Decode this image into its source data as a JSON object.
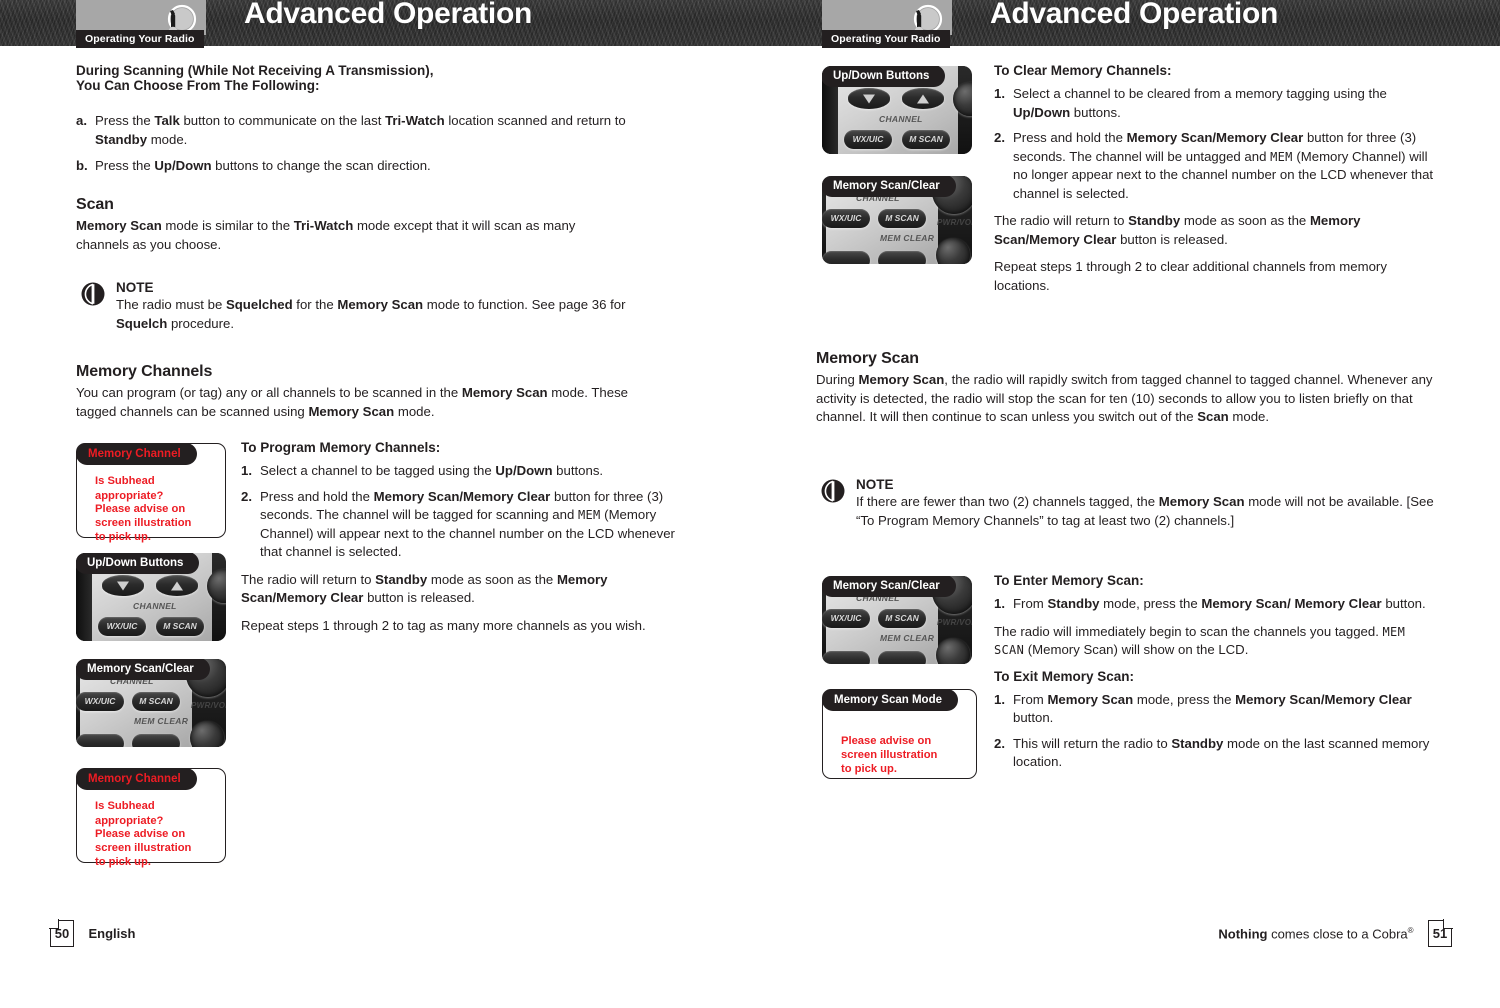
{
  "header": {
    "crumb": "Operating Your Radio",
    "title": "Advanced Operation",
    "logo_icon": "cobra-radio-logo-icon"
  },
  "left_page": {
    "intro_heading_line1": "During Scanning (While Not Receiving A Transmission),",
    "intro_heading_line2": "You Can Choose From The Following:",
    "alpha_items": [
      {
        "marker": "a.",
        "html": "Press the <b>Talk</b> button to communicate on the last <b>Tri-Watch</b> location scanned and return to <b>Standby</b> mode."
      },
      {
        "marker": "b.",
        "html": "Press the <b>Up/Down</b> buttons to change the scan direction."
      }
    ],
    "scan_heading": "Scan",
    "scan_para": "<b>Memory Scan</b> mode is similar to the <b>Tri-Watch</b> mode except that it will scan as many channels as you choose.",
    "note": {
      "title": "NOTE",
      "body": "The radio must be <b>Squelched</b> for the <b>Memory Scan</b> mode to function. See page 36 for <b>Squelch</b> procedure."
    },
    "memch_heading": "Memory Channels",
    "memch_para": "You can program (or tag) any or all channels to be scanned in the <b>Memory Scan</b> mode. These tagged channels can be scanned using <b>Memory Scan</b> mode.",
    "program_heading": "To Program Memory Channels:",
    "program_steps": [
      {
        "marker": "1.",
        "html": "Select a channel to be tagged using the <b>Up/Down</b> buttons."
      },
      {
        "marker": "2.",
        "html": "Press and hold the <b>Memory Scan/Memory Clear</b> button for three (3) seconds. The channel will be tagged for scanning and <span class=\"lcd\">MEM</span> (Memory Channel) will appear next to the channel number on the LCD whenever that channel is selected."
      }
    ],
    "program_after_1": "The radio will return to <b>Standby</b> mode as soon as the <b>Memory Scan/Memory Clear</b> button is released.",
    "program_after_2": "Repeat steps 1 through 2 to tag as many more channels as you wish.",
    "callouts": [
      {
        "tag": "Memory Channel",
        "tag_color": "#ed1c24",
        "type": "advice",
        "lines": [
          "Is Subhead appropriate?",
          "",
          "Please advise on",
          "screen illustration",
          "to pick up."
        ]
      },
      {
        "tag": "Up/Down Buttons",
        "tag_color": "#ffffff",
        "type": "photo",
        "photo": "radio-updown-buttons-photo",
        "photo_labels": [
          "CHANNEL",
          "WX/UIC",
          "M SCAN"
        ]
      },
      {
        "tag": "Memory Scan/Clear",
        "tag_color": "#ffffff",
        "type": "photo",
        "photo": "radio-memory-scan-clear-photo",
        "photo_labels": [
          "CHANNEL",
          "WX/UIC",
          "M SCAN",
          "MEM CLEAR",
          "PWR/VOL"
        ]
      },
      {
        "tag": "Memory Channel",
        "tag_color": "#ed1c24",
        "type": "advice",
        "lines": [
          "Is Subhead appropriate?",
          "",
          "Please advise on",
          "screen illustration",
          "to pick up."
        ]
      }
    ],
    "footer": {
      "page_number": "50",
      "label": "English"
    }
  },
  "right_page": {
    "clear_heading": "To Clear Memory Channels:",
    "clear_steps": [
      {
        "marker": "1.",
        "html": "Select a channel to be cleared from a memory tagging using the <b>Up/Down</b> buttons."
      },
      {
        "marker": "2.",
        "html": "Press and hold the <b>Memory Scan/Memory Clear</b> button for three (3) seconds. The channel will be untagged and <span class=\"lcd\">MEM</span> (Memory Channel) will no longer appear next to the channel number on the LCD whenever that channel is selected."
      }
    ],
    "clear_after_1": "The radio will return to <b>Standby</b> mode as soon as the <b>Memory Scan/Memory Clear</b> button is released.",
    "clear_after_2": "Repeat steps 1 through 2 to clear additional channels from memory locations.",
    "memscan_heading": "Memory Scan",
    "memscan_para": "During <b>Memory Scan</b>, the radio will rapidly switch from tagged channel to tagged channel. Whenever any activity is detected, the radio will stop the scan for ten (10) seconds to allow you to listen briefly on that channel. It will then continue to scan unless you switch out of the <b>Scan</b> mode.",
    "note": {
      "title": "NOTE",
      "body": "If there are fewer than two (2) channels tagged, the <b>Memory Scan</b> mode will not be available. [See “To Program Memory Channels” to tag at least two (2) channels.]"
    },
    "enter_heading": "To Enter Memory Scan:",
    "enter_steps": [
      {
        "marker": "1.",
        "html": "From <b>Standby</b> mode, press the <b>Memory Scan/ Memory Clear</b> button."
      }
    ],
    "enter_after": "The radio will immediately begin to scan the channels you tagged. <span class=\"lcd\">MEM SCAN</span> (Memory Scan) will show on the LCD.",
    "exit_heading": "To Exit Memory Scan:",
    "exit_steps": [
      {
        "marker": "1.",
        "html": "From <b>Memory Scan</b> mode, press the <b>Memory Scan/Memory Clear</b> button."
      },
      {
        "marker": "2.",
        "html": "This will return the radio to <b>Standby</b> mode on the last scanned memory location."
      }
    ],
    "callouts": [
      {
        "tag": "Up/Down Buttons",
        "tag_color": "#ffffff",
        "type": "photo",
        "photo": "radio-updown-buttons-photo",
        "photo_labels": [
          "CHANNEL",
          "WX/UIC",
          "M SCAN"
        ]
      },
      {
        "tag": "Memory Scan/Clear",
        "tag_color": "#ffffff",
        "type": "photo",
        "photo": "radio-memory-scan-clear-photo",
        "photo_labels": [
          "CHANNEL",
          "WX/UIC",
          "M SCAN",
          "MEM CLEAR",
          "PWR/VOL"
        ]
      },
      {
        "tag": "Memory Scan/Clear",
        "tag_color": "#ffffff",
        "type": "photo",
        "photo": "radio-memory-scan-clear-photo",
        "photo_labels": [
          "CHANNEL",
          "WX/UIC",
          "M SCAN",
          "MEM CLEAR",
          "PWR/VOL"
        ]
      },
      {
        "tag": "Memory Scan Mode",
        "tag_color": "#ffffff",
        "type": "advice",
        "lines": [
          "Please advise on",
          "screen illustration",
          "to pick up."
        ]
      }
    ],
    "footer": {
      "tagline_bold": "Nothing",
      "tagline_rest": " comes close to a Cobra",
      "registered": "®",
      "page_number": "51"
    }
  },
  "colors": {
    "ink": "#231f20",
    "red": "#ed1c24",
    "tag_bg": "#231f20",
    "plate": "#a7a7a7"
  }
}
